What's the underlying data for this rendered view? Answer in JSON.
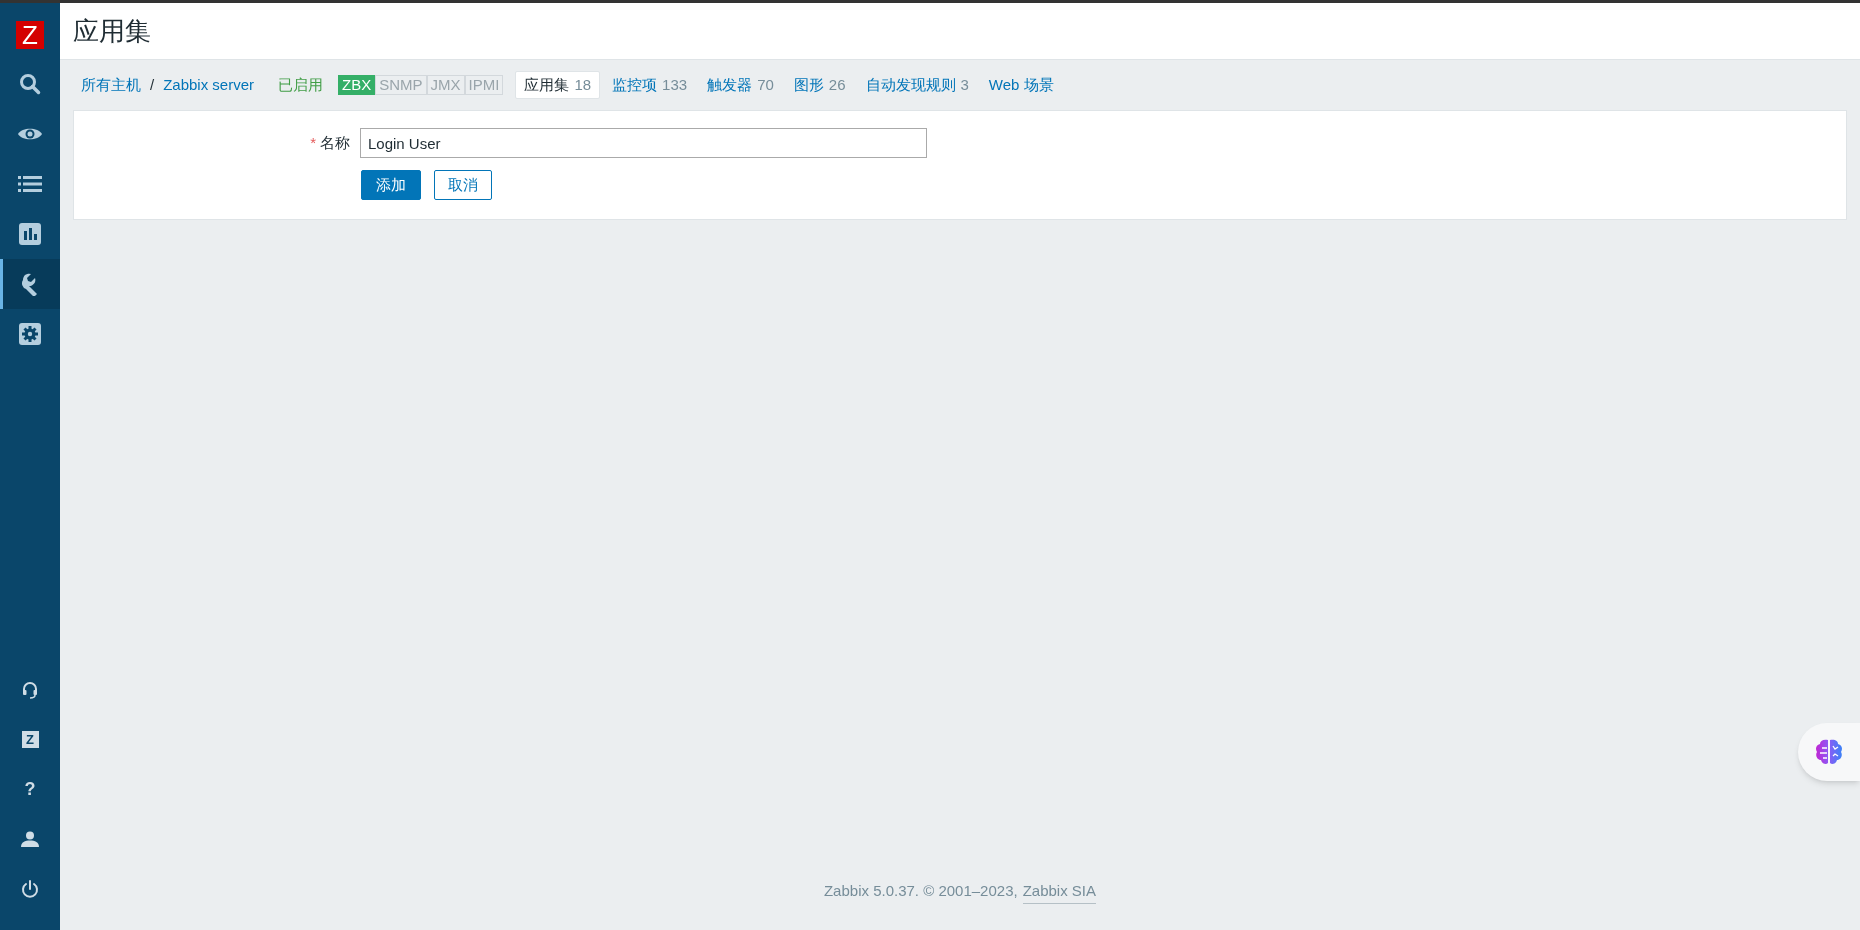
{
  "sidebar": {
    "logo": "Z",
    "items": [
      {
        "kind": "search",
        "selected": false
      },
      {
        "kind": "eye",
        "selected": false
      },
      {
        "kind": "list",
        "selected": false
      },
      {
        "kind": "chart",
        "selected": false
      },
      {
        "kind": "wrench",
        "selected": true
      },
      {
        "kind": "gear",
        "selected": false
      }
    ],
    "bottom_items": [
      {
        "kind": "headset"
      },
      {
        "kind": "letter",
        "text": "Z"
      },
      {
        "kind": "help",
        "text": "?"
      },
      {
        "kind": "user"
      },
      {
        "kind": "power"
      }
    ]
  },
  "header": {
    "title": "应用集"
  },
  "breadcrumbs": [
    "所有主机",
    "Zabbix server"
  ],
  "breadcrumb_separator": "/",
  "host_status": "已启用",
  "availability": [
    {
      "label": "ZBX",
      "available": true
    },
    {
      "label": "SNMP",
      "available": false
    },
    {
      "label": "JMX",
      "available": false
    },
    {
      "label": "IPMI",
      "available": false
    }
  ],
  "tabs": [
    {
      "label": "应用集",
      "count": "18",
      "selected": true
    },
    {
      "label": "监控项",
      "count": "133",
      "selected": false
    },
    {
      "label": "触发器",
      "count": "70",
      "selected": false
    },
    {
      "label": "图形",
      "count": "26",
      "selected": false
    },
    {
      "label": "自动发现规则",
      "count": "3",
      "selected": false
    },
    {
      "label": "Web 场景",
      "selected": false
    }
  ],
  "form": {
    "required_mark": "*",
    "label": "名称",
    "value": "Login User",
    "buttons": [
      {
        "label": "添加",
        "kind": "primary"
      },
      {
        "label": "取消",
        "kind": "secondary"
      }
    ]
  },
  "footer": {
    "text": "Zabbix 5.0.37. © 2001–2023,",
    "link": "Zabbix SIA"
  }
}
